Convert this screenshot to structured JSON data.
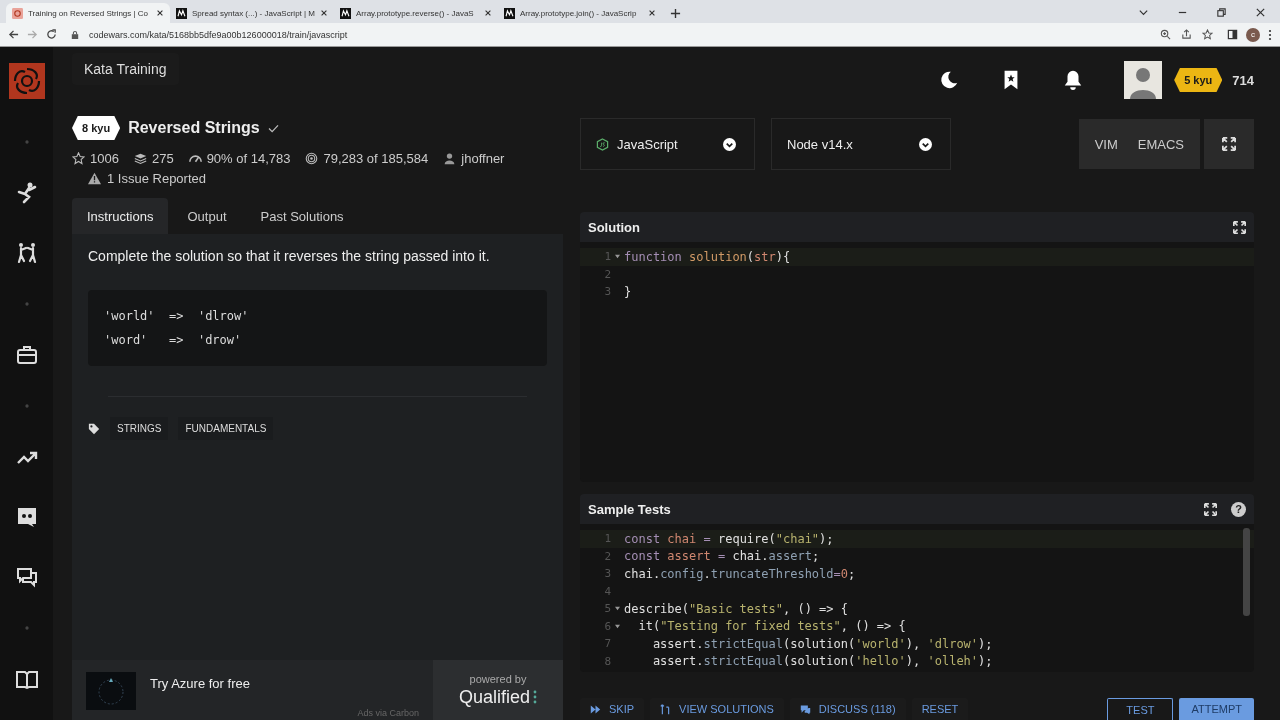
{
  "browser": {
    "tabs": [
      {
        "title": "Training on Reversed Strings | Co",
        "selected": true,
        "kind": "site"
      },
      {
        "title": "Spread syntax (...) - JavaScript | M",
        "selected": false,
        "kind": "docs"
      },
      {
        "title": "Array.prototype.reverse() - JavaS",
        "selected": false,
        "kind": "docs"
      },
      {
        "title": "Array.prototype.join() - JavaScrip",
        "selected": false,
        "kind": "docs"
      }
    ],
    "url": "codewars.com/kata/5168bb5dfe9a00b126000018/train/javascript",
    "profile_initial": "c"
  },
  "header": {
    "section": "Kata Training",
    "rank": "5 kyu",
    "honor": "714"
  },
  "kata": {
    "rank": "8 kyu",
    "title": "Reversed Strings",
    "stats": [
      {
        "kind": "stars",
        "text": "1006"
      },
      {
        "kind": "collections",
        "text": "275"
      },
      {
        "kind": "satisfaction",
        "text": "90% of 14,783"
      },
      {
        "kind": "completed",
        "text": "79,283 of 185,584"
      },
      {
        "kind": "author",
        "text": "jhoffner"
      }
    ],
    "issues": "1 Issue Reported"
  },
  "tabs": [
    {
      "label": "Instructions",
      "selected": true
    },
    {
      "label": "Output",
      "selected": false
    },
    {
      "label": "Past Solutions",
      "selected": false
    }
  ],
  "instructions": {
    "text": "Complete the solution so that it reverses the string passed into it.",
    "example": [
      "'world'  =>  'dlrow'",
      "'word'   =>  'drow'"
    ],
    "tags": [
      "STRINGS",
      "FUNDAMENTALS"
    ]
  },
  "ad": {
    "text": "Try Azure for free",
    "note": "Ads via Carbon",
    "powered_by": "powered by",
    "brand": "Qualified"
  },
  "editor_settings": {
    "language": "JavaScript",
    "runtime": "Node v14.x",
    "modes": [
      "VIM",
      "EMACS"
    ]
  },
  "solution": {
    "title": "Solution",
    "lines": [
      {
        "number": "1",
        "fold": true,
        "tokens": [
          {
            "kind": "kw",
            "text": "function "
          },
          {
            "kind": "fn",
            "text": "solution"
          },
          {
            "kind": "plain",
            "text": "("
          },
          {
            "kind": "var",
            "text": "str"
          },
          {
            "kind": "plain",
            "text": "){"
          }
        ]
      },
      {
        "number": "2",
        "fold": false
      },
      {
        "number": "3",
        "fold": false,
        "tokens": [
          {
            "kind": "plain",
            "text": "}"
          }
        ]
      }
    ]
  },
  "tests": {
    "title": "Sample Tests",
    "help": "?",
    "lines": [
      {
        "number": "1",
        "fold": false,
        "tokens": [
          {
            "kind": "kw",
            "text": "const "
          },
          {
            "kind": "var",
            "text": "chai"
          },
          {
            "kind": "kw",
            "text": " = "
          },
          {
            "kind": "plain",
            "text": "require("
          },
          {
            "kind": "str",
            "text": "\"chai\""
          },
          {
            "kind": "plain",
            "text": ");"
          }
        ]
      },
      {
        "number": "2",
        "fold": false,
        "tokens": [
          {
            "kind": "kw",
            "text": "const "
          },
          {
            "kind": "var",
            "text": "assert"
          },
          {
            "kind": "kw",
            "text": " = "
          },
          {
            "kind": "plain",
            "text": "chai."
          },
          {
            "kind": "prop",
            "text": "assert"
          },
          {
            "kind": "plain",
            "text": ";"
          }
        ]
      },
      {
        "number": "3",
        "fold": false,
        "tokens": [
          {
            "kind": "plain",
            "text": "chai."
          },
          {
            "kind": "prop",
            "text": "config"
          },
          {
            "kind": "plain",
            "text": "."
          },
          {
            "kind": "prop",
            "text": "truncateThreshold"
          },
          {
            "kind": "kw",
            "text": "="
          },
          {
            "kind": "num",
            "text": "0"
          },
          {
            "kind": "plain",
            "text": ";"
          }
        ]
      },
      {
        "number": "4",
        "fold": false
      },
      {
        "number": "5",
        "fold": true,
        "tokens": [
          {
            "kind": "plain",
            "text": "describe("
          },
          {
            "kind": "str",
            "text": "\"Basic tests\""
          },
          {
            "kind": "plain",
            "text": ", () => {"
          }
        ]
      },
      {
        "number": "6",
        "fold": true,
        "tokens": [
          {
            "kind": "plain",
            "text": "  it("
          },
          {
            "kind": "str",
            "text": "\"Testing for fixed tests\""
          },
          {
            "kind": "plain",
            "text": ", () => {"
          }
        ]
      },
      {
        "number": "7",
        "fold": false,
        "tokens": [
          {
            "kind": "plain",
            "text": "    assert."
          },
          {
            "kind": "prop",
            "text": "strictEqual"
          },
          {
            "kind": "plain",
            "text": "(solution("
          },
          {
            "kind": "str",
            "text": "'world'"
          },
          {
            "kind": "plain",
            "text": "), "
          },
          {
            "kind": "str",
            "text": "'dlrow'"
          },
          {
            "kind": "plain",
            "text": ");"
          }
        ]
      },
      {
        "number": "8",
        "fold": false,
        "tokens": [
          {
            "kind": "plain",
            "text": "    assert."
          },
          {
            "kind": "prop",
            "text": "strictEqual"
          },
          {
            "kind": "plain",
            "text": "(solution("
          },
          {
            "kind": "str",
            "text": "'hello'"
          },
          {
            "kind": "plain",
            "text": "), "
          },
          {
            "kind": "str",
            "text": "'olleh'"
          },
          {
            "kind": "plain",
            "text": ");"
          }
        ]
      }
    ]
  },
  "actions": [
    {
      "kind": "skip",
      "label": "SKIP"
    },
    {
      "kind": "solutions",
      "label": "VIEW SOLUTIONS"
    },
    {
      "kind": "discuss",
      "label": "DISCUSS (118)"
    },
    {
      "kind": "plain",
      "label": "RESET"
    },
    {
      "kind": "outline",
      "label": "TEST"
    },
    {
      "kind": "primary",
      "label": "ATTEMPT"
    }
  ]
}
